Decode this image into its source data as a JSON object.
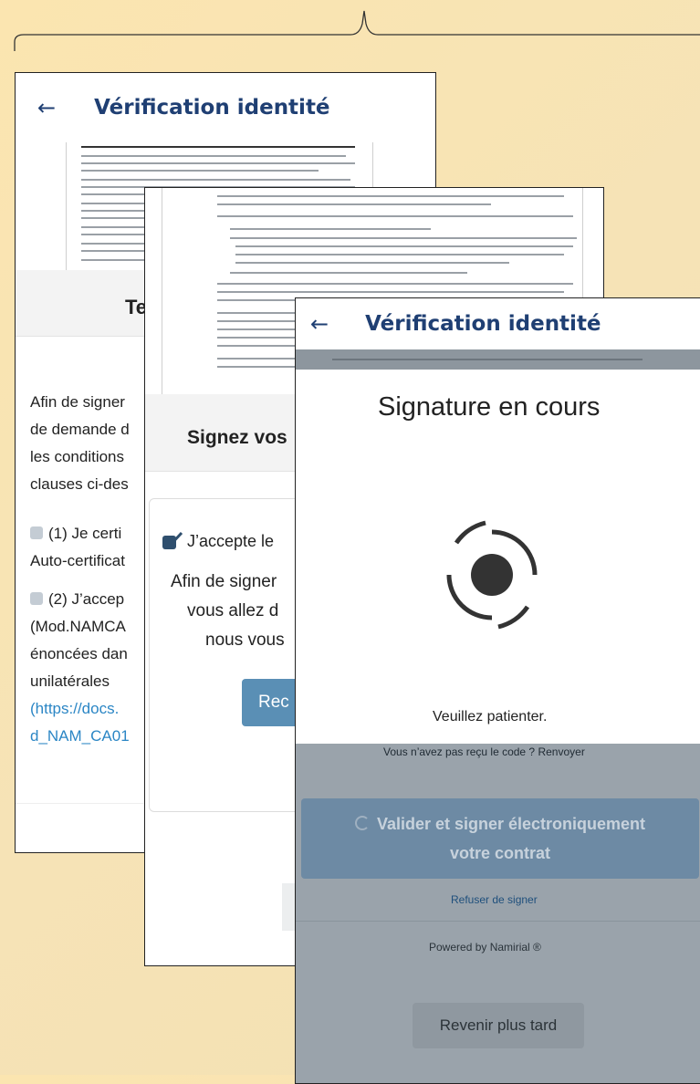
{
  "screen1": {
    "back_icon": "arrow-left-icon",
    "title": "Vérification identité",
    "partial_heading": "Te",
    "paragraph_lines": [
      "Afin de signer",
      "de demande d",
      "les conditions",
      "clauses ci-des"
    ],
    "check1_lines": [
      "(1) Je certi",
      "Auto-certificat"
    ],
    "check2_lines": [
      "(2) J’accep",
      "(Mod.NAMCA",
      "énoncées dan",
      "unilatérales"
    ],
    "link_lines": [
      "(https://docs.",
      "d_NAM_CA01"
    ]
  },
  "screen2": {
    "heading_partial": "Signez vos",
    "accept_label": "J’accepte le",
    "body_lines": [
      "Afin de signer",
      "vous allez d",
      "nous vous"
    ],
    "button_partial": "Rec"
  },
  "screen3": {
    "back_icon": "arrow-left-icon",
    "title": "Vérification identité",
    "modal_title": "Signature en cours",
    "modal_message": "Veuillez patienter.",
    "no_code_text": "Vous n’avez pas reçu le code ?",
    "resend_link": "Renvoyer",
    "validate_button_line1": "Valider et signer électroniquement",
    "validate_button_line2": "votre contrat",
    "refuse_link": "Refuser de signer",
    "powered_by": "Powered by Namirial ®",
    "later_button": "Revenir plus tard"
  },
  "colors": {
    "brand_navy": "#1f3f73",
    "button_blue": "#5a8fb5",
    "link_blue": "#2b86c5",
    "background": "#f6e3b6"
  }
}
